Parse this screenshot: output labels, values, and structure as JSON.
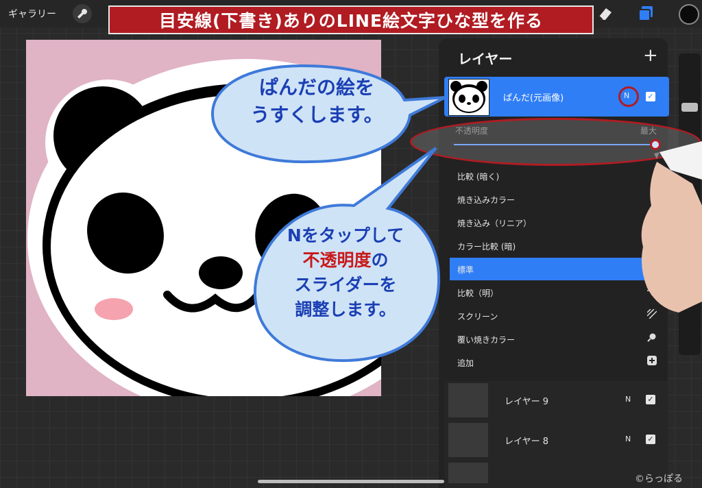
{
  "toolbar": {
    "gallery_label": "ギャラリー",
    "wrench_icon": "wrench-icon",
    "eraser_icon": "eraser-icon",
    "layers_icon": "layers-icon",
    "current_color": "#0b0b0b"
  },
  "banner": {
    "text": "目安線(下書き)ありのLINE絵文字ひな型を作る"
  },
  "bubbles": {
    "top_line1": "ぱんだの絵を",
    "top_line2": "うすくします。",
    "bottom_line1": "Nをタップして",
    "bottom_line2a": "不透明度",
    "bottom_line2b": "の",
    "bottom_line3": "スライダーを",
    "bottom_line4": "調整します。"
  },
  "layers_panel": {
    "title": "レイヤー",
    "add_icon": "+",
    "active_layer": {
      "name": "ぱんだ(元画像)",
      "mode": "N",
      "visible": true
    },
    "opacity": {
      "label": "不透明度",
      "max_label": "最大",
      "value": 1.0
    },
    "blend_modes": [
      {
        "label": "比較 (暗く)",
        "icon": ""
      },
      {
        "label": "焼き込みカラー",
        "icon": ""
      },
      {
        "label": "焼き込み（リニア）",
        "icon": ""
      },
      {
        "label": "カラー比較 (暗)",
        "icon": ""
      },
      {
        "label": "標準",
        "icon": "",
        "selected": true
      },
      {
        "label": "比較（明）",
        "icon": "sun-icon"
      },
      {
        "label": "スクリーン",
        "icon": "hatch-icon"
      },
      {
        "label": "覆い焼きカラー",
        "icon": "magnifier-icon"
      },
      {
        "label": "追加",
        "icon": "plus-square-icon"
      }
    ],
    "layers": [
      {
        "name": "レイヤー 9",
        "mode": "N",
        "visible": true
      },
      {
        "name": "レイヤー 8",
        "mode": "N",
        "visible": true
      }
    ]
  },
  "watermark": "©らっぽる",
  "colors": {
    "accent_blue": "#2f7ef6",
    "annotation_red": "#b01c22",
    "canvas_pink": "#e0b3c5",
    "bubble_blue": "#cfe3f7"
  }
}
